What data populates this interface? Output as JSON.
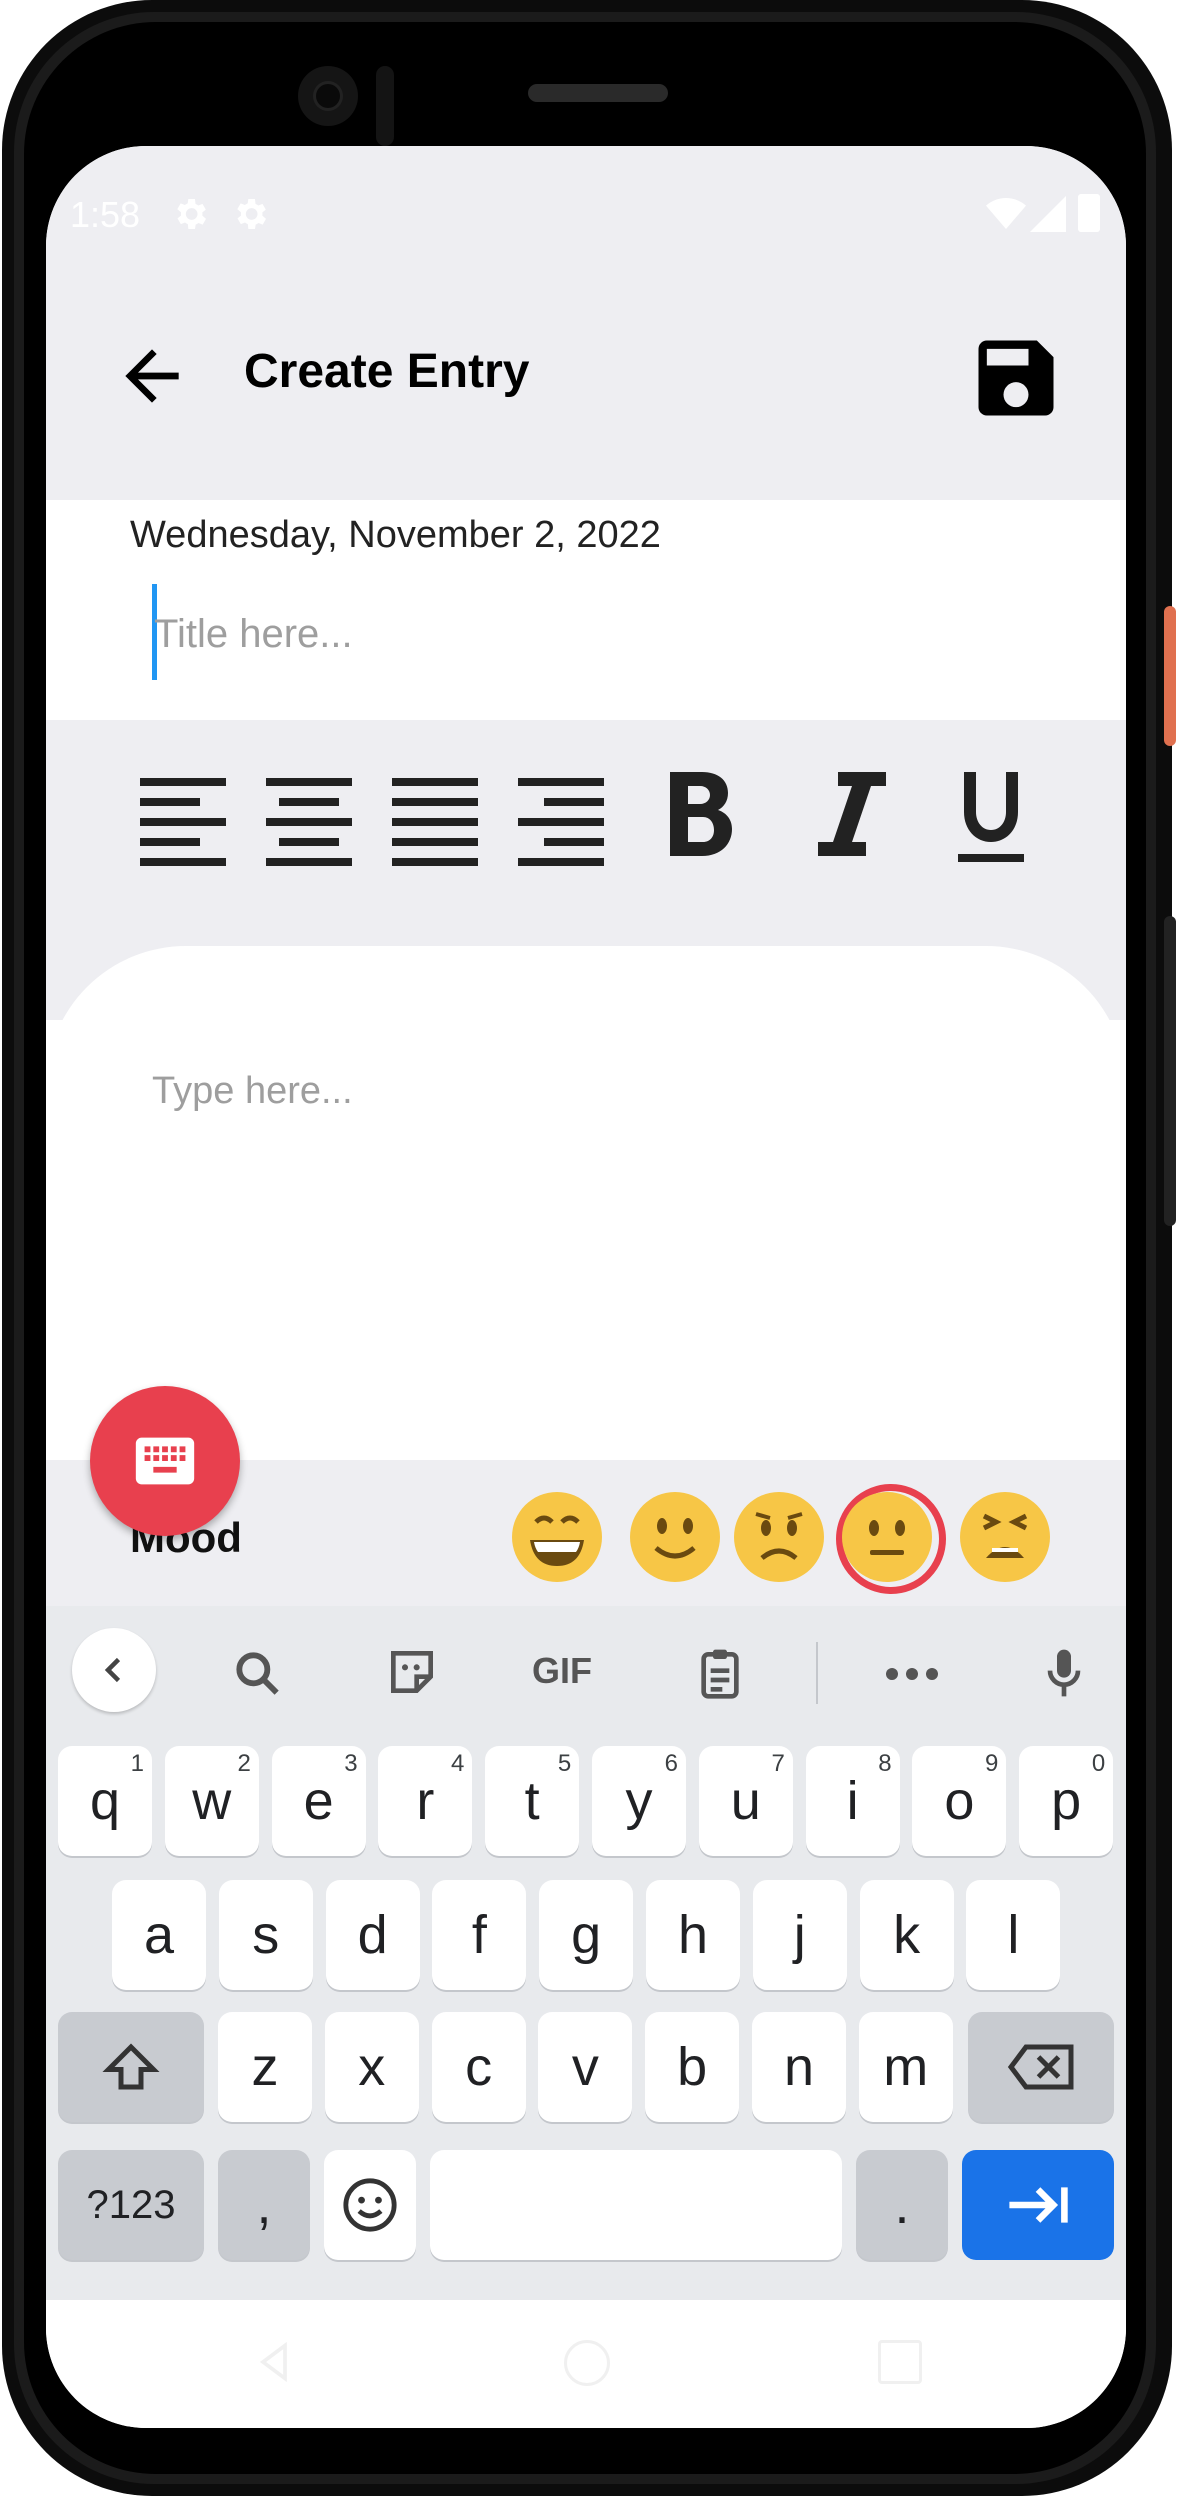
{
  "status_bar": {
    "time": "1:58"
  },
  "app_bar": {
    "title": "Create Entry",
    "back_icon": "arrow-left-icon",
    "save_icon": "floppy-disk-icon"
  },
  "entry": {
    "date": "Wednesday, November 2, 2022",
    "title_placeholder": "Title here...",
    "body_placeholder": "Type here..."
  },
  "format_toolbar": {
    "items": [
      "align-left-icon",
      "align-center-icon",
      "align-justify-icon",
      "align-right-icon",
      "bold-icon",
      "italic-icon",
      "underline-icon"
    ]
  },
  "mood": {
    "label": "Mood",
    "options": [
      "grinning-face",
      "slightly-smiling-face",
      "frowning-face",
      "neutral-face",
      "weary-face"
    ],
    "selected": "neutral-face",
    "selected_color": "#e8404e"
  },
  "fab": {
    "icon": "keyboard-icon",
    "color": "#e8404e"
  },
  "keyboard": {
    "toolbar": [
      "back-chevron-icon",
      "search-icon",
      "sticker-icon",
      "gif-icon",
      "clipboard-icon",
      "more-icon",
      "mic-icon"
    ],
    "gif_label": "GIF",
    "row1": [
      {
        "k": "q",
        "h": "1"
      },
      {
        "k": "w",
        "h": "2"
      },
      {
        "k": "e",
        "h": "3"
      },
      {
        "k": "r",
        "h": "4"
      },
      {
        "k": "t",
        "h": "5"
      },
      {
        "k": "y",
        "h": "6"
      },
      {
        "k": "u",
        "h": "7"
      },
      {
        "k": "i",
        "h": "8"
      },
      {
        "k": "o",
        "h": "9"
      },
      {
        "k": "p",
        "h": "0"
      }
    ],
    "row2": [
      "a",
      "s",
      "d",
      "f",
      "g",
      "h",
      "j",
      "k",
      "l"
    ],
    "row3": [
      "z",
      "x",
      "c",
      "v",
      "b",
      "n",
      "m"
    ],
    "symbols_label": "?123",
    "comma": ",",
    "period": ".",
    "enter_color": "#1a73e8"
  }
}
